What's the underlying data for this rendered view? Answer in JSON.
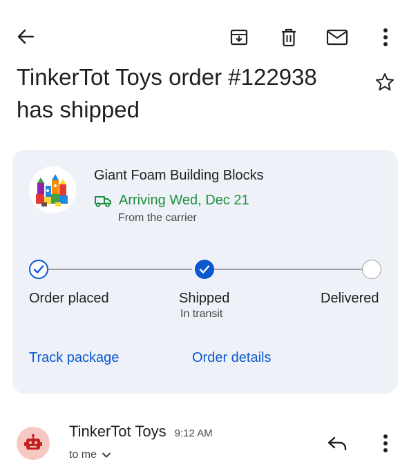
{
  "toolbar": {
    "back_icon": "arrow-left-icon",
    "archive_icon": "archive-icon",
    "delete_icon": "trash-icon",
    "mark_unread_icon": "mail-icon",
    "more_icon": "more-vert-icon"
  },
  "email": {
    "subject": "TinkerTot Toys order #122938 has shipped",
    "star_icon": "star-outline-icon"
  },
  "shipment_card": {
    "product_name": "Giant Foam Building Blocks",
    "arrival_text": "Arriving Wed, Dec 21",
    "arrival_icon": "truck-icon",
    "source": "From the carrier",
    "steps": [
      {
        "label": "Order placed",
        "sublabel": "",
        "state": "done"
      },
      {
        "label": "Shipped",
        "sublabel": "In transit",
        "state": "current"
      },
      {
        "label": "Delivered",
        "sublabel": "",
        "state": "pending"
      }
    ],
    "links": {
      "track": "Track package",
      "details": "Order details"
    }
  },
  "message": {
    "sender": "TinkerTot Toys",
    "time": "9:12 AM",
    "recipient": "to me",
    "avatar_icon": "robot-icon",
    "reply_icon": "reply-icon",
    "more_icon": "more-vert-icon"
  },
  "colors": {
    "accent_blue": "#0b57d0",
    "arrival_green": "#1e8e3e",
    "card_bg": "#eef1f8",
    "avatar_bg": "#f6c7c3"
  }
}
